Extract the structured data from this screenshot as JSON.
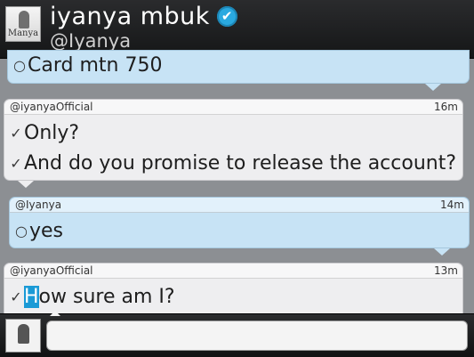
{
  "header": {
    "avatar_label": "Manya",
    "name": "iyanya mbuk",
    "verified_icon": "✔",
    "handle": "@Iyanya"
  },
  "messages": [
    {
      "sender": "",
      "time": "",
      "lines": [
        {
          "mark": "○",
          "text": "Card mtn 750"
        }
      ]
    },
    {
      "sender": "@iyanyaOfficial",
      "time": "16m",
      "lines": [
        {
          "mark": "✓",
          "text": "Only?"
        },
        {
          "mark": "✓",
          "text": "And do you promise to release the account?"
        }
      ]
    },
    {
      "sender": "@Iyanya",
      "time": "14m",
      "lines": [
        {
          "mark": "○",
          "text": "yes"
        }
      ]
    },
    {
      "sender": "@iyanyaOfficial",
      "time": "13m",
      "lines": [
        {
          "mark": "✓",
          "highlight": "H",
          "text": "ow sure am I?"
        }
      ]
    }
  ],
  "composer": {
    "value": ""
  },
  "icons": {
    "sent_mark": "checkmark-icon",
    "pending_mark": "circle-icon",
    "verified": "verified-badge-icon"
  },
  "colors": {
    "own_bubble": "#c7e3f5",
    "other_bubble": "#eeeef0",
    "verified": "#2aa9e0",
    "cursor": "#1a9ad6"
  }
}
